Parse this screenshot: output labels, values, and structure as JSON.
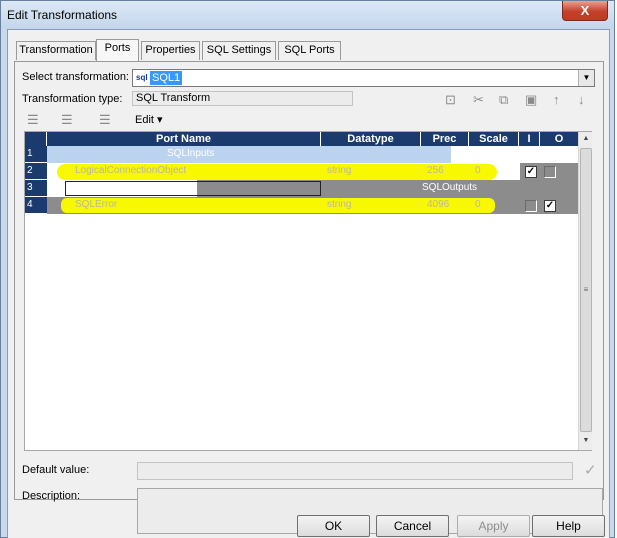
{
  "window": {
    "title": "Edit Transformations",
    "close_label": "X"
  },
  "tabs": [
    {
      "label": "Transformation"
    },
    {
      "label": "Ports"
    },
    {
      "label": "Properties"
    },
    {
      "label": "SQL Settings"
    },
    {
      "label": "SQL Ports"
    }
  ],
  "active_tab": "Ports",
  "select_transformation": {
    "label": "Select transformation:",
    "icon_text": "sql",
    "value": "SQL1"
  },
  "transformation_type": {
    "label": "Transformation type:",
    "value": "SQL Transform"
  },
  "toolbar": {
    "edit_label": "Edit"
  },
  "grid": {
    "columns": [
      "Port Name",
      "Datatype",
      "Prec",
      "Scale",
      "I",
      "O"
    ],
    "rows": [
      {
        "num": "1",
        "group": "SQLInputs"
      },
      {
        "num": "2",
        "port_name": "LogicalConnectionObject",
        "datatype": "string",
        "prec": "256",
        "scale": "0",
        "input": true,
        "output": false
      },
      {
        "num": "3",
        "group": "SQLOutputs"
      },
      {
        "num": "4",
        "port_name": "SQLError",
        "datatype": "string",
        "prec": "4096",
        "scale": "0",
        "input": false,
        "output": true
      }
    ],
    "highlight_color": "#f8f800",
    "header_color": "#1b3a6e"
  },
  "default_value": {
    "label": "Default value:",
    "value": ""
  },
  "description": {
    "label": "Description:",
    "value": ""
  },
  "buttons": {
    "ok": "OK",
    "cancel": "Cancel",
    "apply": "Apply",
    "help": "Help"
  }
}
